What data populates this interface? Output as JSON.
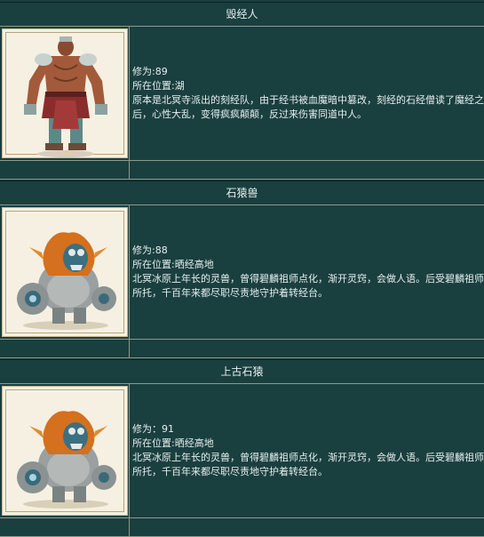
{
  "cards": [
    {
      "title": "毁经人",
      "level": "修为:89",
      "location": "所在位置:湖",
      "description": "原本是北冥寺派出的刻经队，由于经书被血魔暗中篡改，刻经的石经僧读了魔经之后，心性大乱，变得疯疯颠颠，反过来伤害同道中人。",
      "portrait_icon": "warrior-monk-portrait"
    },
    {
      "title": "石猿兽",
      "level": "修为:88",
      "location": "所在位置:晒经高地",
      "description": "北冥冰原上年长的灵兽，曾得碧麟祖师点化，渐开灵窍，会做人语。后受碧麟祖师所托，千百年来都尽职尽责地守护着转经台。",
      "portrait_icon": "stone-ape-portrait"
    },
    {
      "title": "上古石猿",
      "level": "修为：91",
      "location": "所在位置:晒经高地",
      "description": "北冥冰原上年长的灵兽，曾得碧麟祖师点化，渐开灵窍，会做人语。后受碧麟祖师所托，千百年来都尽职尽责地守护着转经台。",
      "portrait_icon": "stone-ape-portrait"
    }
  ]
}
